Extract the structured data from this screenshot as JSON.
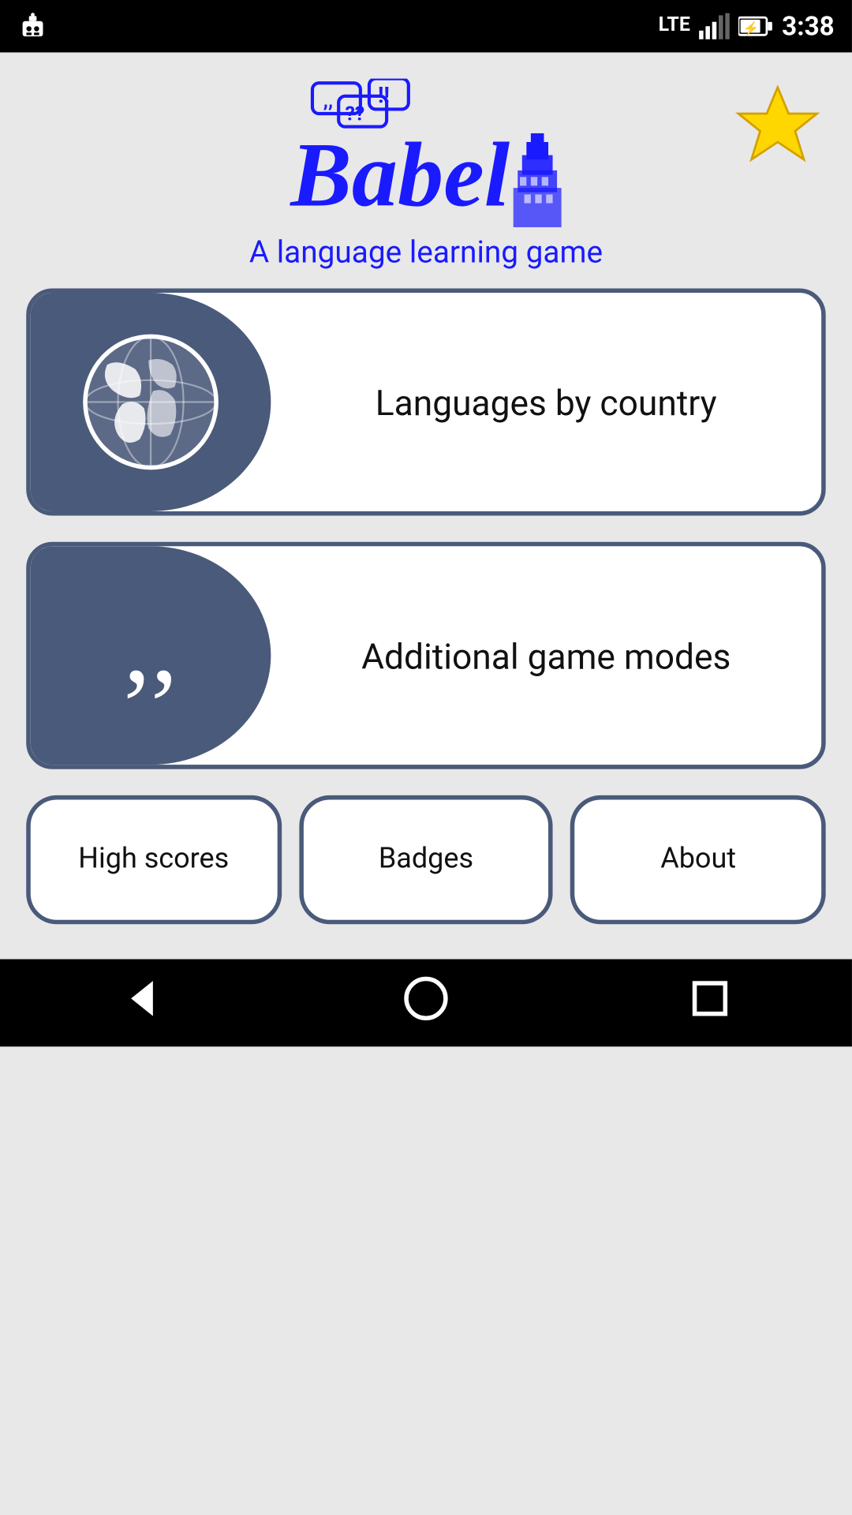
{
  "statusBar": {
    "time": "3:38",
    "signal": "LTE",
    "battery": "⚡"
  },
  "header": {
    "appName": "Babel",
    "subtitle": "A language learning game",
    "starLabel": "⭐"
  },
  "cards": [
    {
      "id": "languages-by-country",
      "label": "Languages by\ncountry",
      "iconType": "globe"
    },
    {
      "id": "additional-game-modes",
      "label": "Additional game modes",
      "iconType": "quotes"
    }
  ],
  "bottomButtons": [
    {
      "id": "high-scores",
      "label": "High scores"
    },
    {
      "id": "badges",
      "label": "Badges"
    },
    {
      "id": "about",
      "label": "About"
    }
  ],
  "navBar": {
    "back": "◁",
    "home": "○",
    "recent": "□"
  }
}
